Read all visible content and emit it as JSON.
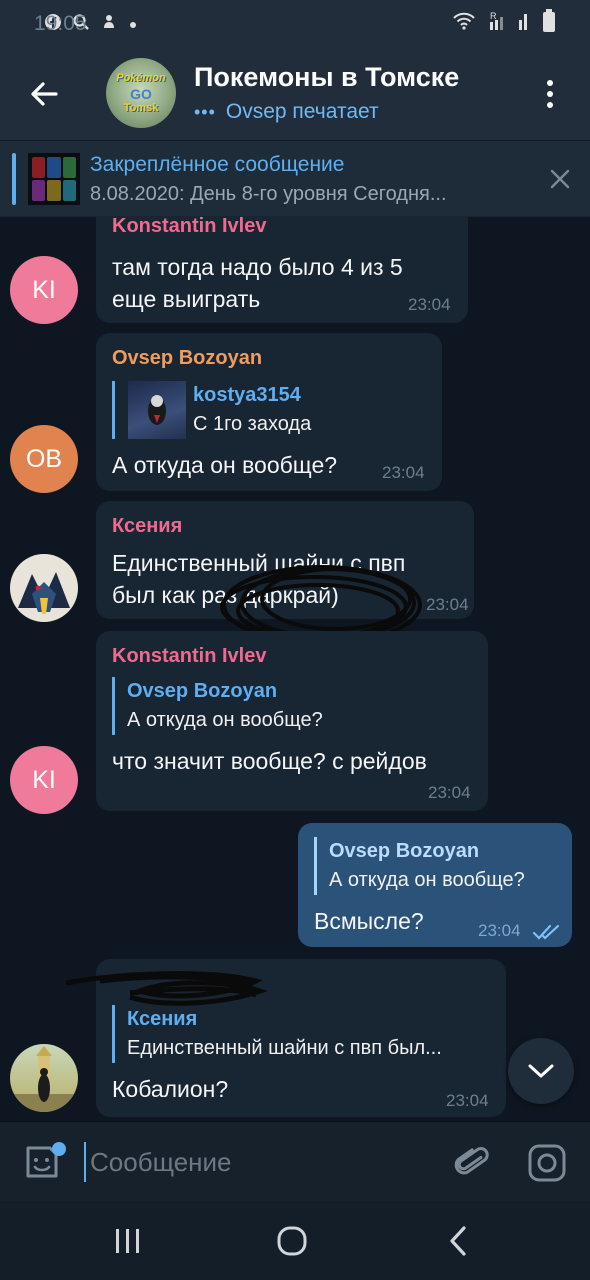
{
  "status_bar": {
    "time": "19:05",
    "icons_left": [
      "facebook-icon",
      "search-icon",
      "app-icon",
      "dot-icon"
    ],
    "icons_right": [
      "wifi-icon",
      "signal-r-icon",
      "signal-icon",
      "battery-icon"
    ]
  },
  "header": {
    "title": "Покемоны в Томске",
    "typing_dots": "•••",
    "typing_status": "Ovsep печатает",
    "avatar_logo": [
      "Pokémon",
      "GO",
      "Tomsk"
    ]
  },
  "pinned": {
    "title": "Закреплённое сообщение",
    "text": "8.08.2020: День 8-го уровня  Сегодня..."
  },
  "messages": [
    {
      "sender": "Konstantin Ivlev",
      "sender_color": "#f06a8f",
      "avatar_initials": "KI",
      "avatar_color": "#f07a9a",
      "lines": [
        "там тогда надо было 4 из 5",
        "еще выиграть"
      ],
      "time": "23:04"
    },
    {
      "sender": "Ovsep Bozoyan",
      "sender_color": "#f09c5c",
      "avatar_initials": "OB",
      "avatar_color": "#e0834f",
      "reply": {
        "name": "kostya3154",
        "text": "С 1го захода"
      },
      "lines": [
        "А откуда он вообще?"
      ],
      "time": "23:04"
    },
    {
      "sender": "Ксения",
      "sender_color": "#f06a8f",
      "lines": [
        "Единственный шайни с пвп",
        "был как раз даркрай)"
      ],
      "time": "23:04"
    },
    {
      "sender": "Konstantin Ivlev",
      "sender_color": "#f06a8f",
      "avatar_initials": "KI",
      "avatar_color": "#f07a9a",
      "reply": {
        "name": "Ovsep Bozoyan",
        "text": "А откуда он вообще?"
      },
      "lines": [
        "что значит вообще? с рейдов"
      ],
      "time": "23:04"
    },
    {
      "outgoing": true,
      "reply": {
        "name": "Ovsep Bozoyan",
        "text": "А откуда он вообще?"
      },
      "lines": [
        "Всмысле?"
      ],
      "time": "23:04",
      "status": "read-double-check-icon"
    },
    {
      "reply": {
        "name": "Ксения",
        "text": "Единственный шайни с пвп был..."
      },
      "lines": [
        "Кобалион?"
      ],
      "time": "23:04"
    }
  ],
  "composer": {
    "placeholder": "Сообщение"
  },
  "colors": {
    "accent": "#5eaef0",
    "chat_bg": "#0e1621",
    "incoming_bubble": "#182533",
    "outgoing_bubble": "#2b5278",
    "header_bg": "#212d3b"
  }
}
